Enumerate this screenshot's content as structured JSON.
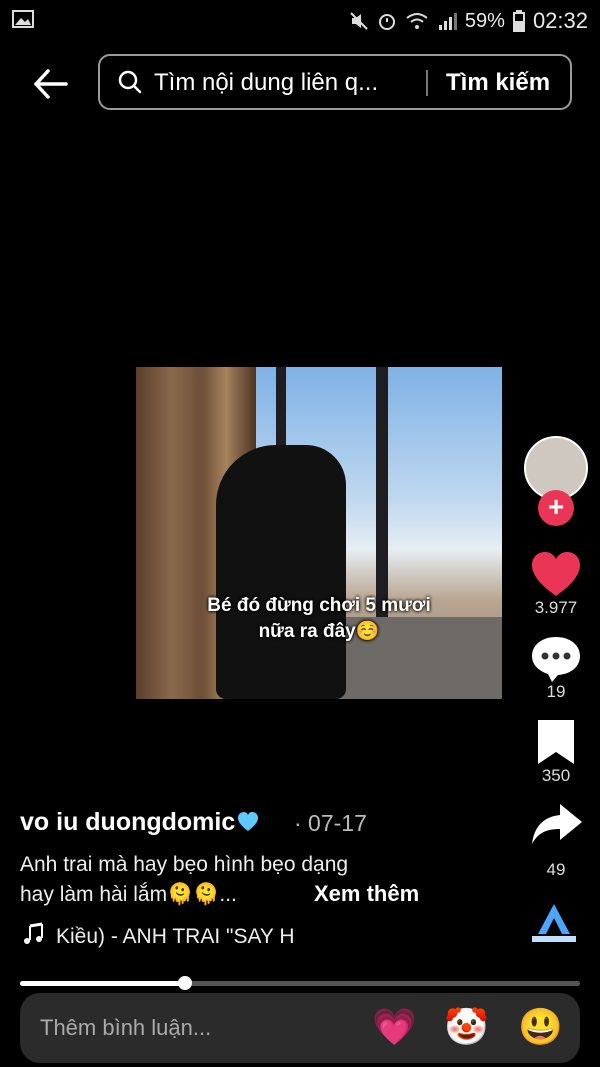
{
  "status_bar": {
    "battery": "59%",
    "time": "02:32"
  },
  "search": {
    "placeholder": "Tìm nội dung liên q...",
    "button": "Tìm kiếm"
  },
  "video": {
    "caption_line1": "Bé đó đừng chơi 5 mươi",
    "caption_line2": "nữa ra đây☺️"
  },
  "rail": {
    "likes": "3.977",
    "comments": "19",
    "saves": "350",
    "shares": "49"
  },
  "post": {
    "username": "vo iu duongdomic",
    "date": "· 07-17",
    "desc_line1": "Anh trai mà hay bẹo hình bẹo dạng",
    "desc_line2": "hay làm hài lắm🫠🫠...",
    "more": "Xem thêm",
    "music": "Kiều) - ANH TRAI \"SAY H"
  },
  "progress": {
    "fraction": 0.295
  },
  "comment_bar": {
    "placeholder": "Thêm bình luận...",
    "emojis": [
      "💗",
      "🤡",
      "😃"
    ]
  },
  "colors": {
    "like": "#ea3557",
    "follow": "#ea3557"
  }
}
